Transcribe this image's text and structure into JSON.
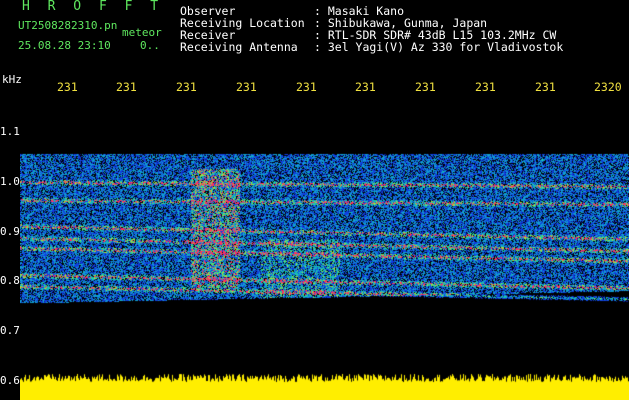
{
  "header": {
    "title": "H R O F F T",
    "filename": "UT2508282310.pn",
    "type": "meteor",
    "datetime": "25.08.28 23:10",
    "extra": "0.."
  },
  "info": [
    {
      "label": "Observer",
      "value": ": Masaki Kano"
    },
    {
      "label": "Receiving Location",
      "value": ": Shibukawa, Gunma, Japan"
    },
    {
      "label": "Receiver",
      "value": ": RTL-SDR SDR# 43dB L15 103.2MHz CW"
    },
    {
      "label": "Receiving Antenna",
      "value": ": 3el Yagi(V) Az 330 for Vladivostok"
    }
  ],
  "axes": {
    "y_unit": "kHz",
    "x_ticks": [
      "231",
      "231",
      "231",
      "231",
      "231",
      "231",
      "231",
      "231",
      "231",
      "2320"
    ],
    "y_ticks": [
      "1.1",
      "1.0",
      "0.9",
      "0.8",
      "0.7",
      "0.6"
    ]
  },
  "colors": {
    "background": "#000000",
    "header_green": "#5fe85f",
    "tick_yellow": "#f0e040",
    "signal_red": "#ff3060",
    "noise_blue": "#1030d0",
    "level_yellow": "#ffee00"
  }
}
